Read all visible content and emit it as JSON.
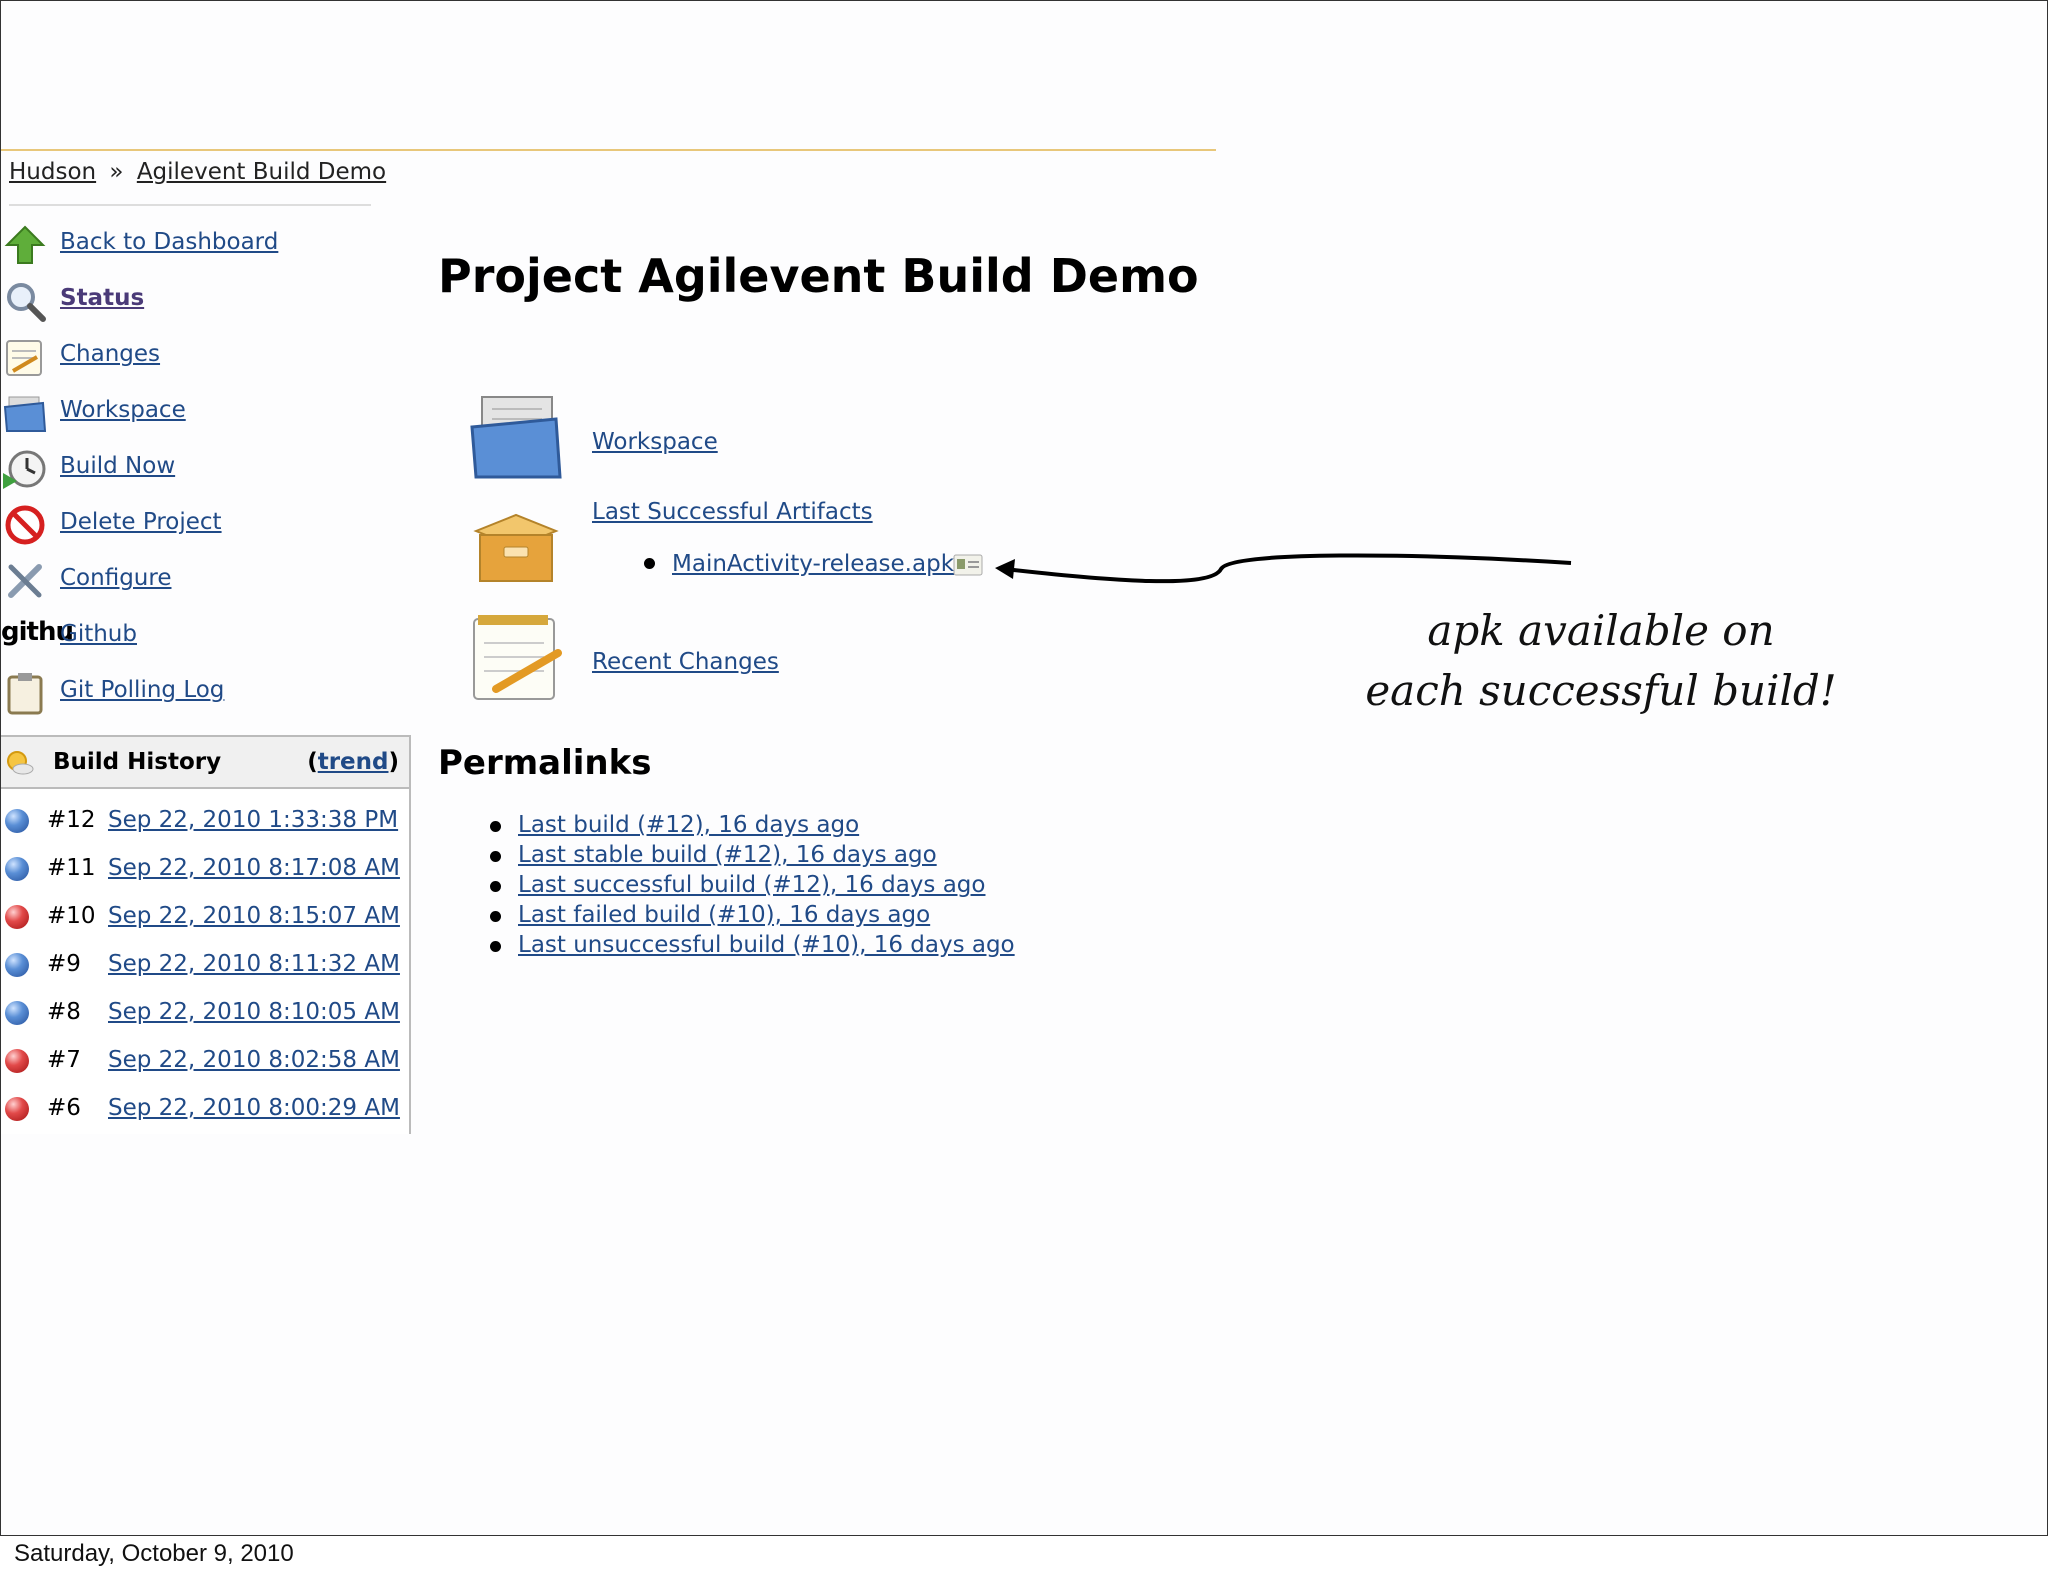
{
  "breadcrumb": {
    "root": "Hudson",
    "separator": "»",
    "project": "Agilevent Build Demo"
  },
  "sidebar": {
    "items": [
      {
        "label": "Back to Dashboard",
        "icon": "up-arrow-icon"
      },
      {
        "label": "Status",
        "icon": "magnifier-icon"
      },
      {
        "label": "Changes",
        "icon": "notepad-icon"
      },
      {
        "label": "Workspace",
        "icon": "folder-icon"
      },
      {
        "label": "Build Now",
        "icon": "clock-icon"
      },
      {
        "label": "Delete Project",
        "icon": "no-entry-icon"
      },
      {
        "label": "Configure",
        "icon": "tools-icon"
      },
      {
        "label": "Github",
        "icon": "github-icon",
        "icon_text": "githu"
      },
      {
        "label": "Git Polling Log",
        "icon": "clipboard-icon"
      }
    ]
  },
  "build_history": {
    "title": "Build History",
    "trend_open": "(",
    "trend_label": "trend",
    "trend_close": ")",
    "builds": [
      {
        "number": "#12",
        "date": "Sep 22, 2010 1:33:38 PM",
        "status": "blue"
      },
      {
        "number": "#11",
        "date": "Sep 22, 2010 8:17:08 AM",
        "status": "blue"
      },
      {
        "number": "#10",
        "date": "Sep 22, 2010 8:15:07 AM",
        "status": "red"
      },
      {
        "number": "#9",
        "date": "Sep 22, 2010 8:11:32 AM",
        "status": "blue"
      },
      {
        "number": "#8",
        "date": "Sep 22, 2010 8:10:05 AM",
        "status": "blue"
      },
      {
        "number": "#7",
        "date": "Sep 22, 2010 8:02:58 AM",
        "status": "red"
      },
      {
        "number": "#6",
        "date": "Sep 22, 2010 8:00:29 AM",
        "status": "red"
      }
    ]
  },
  "main": {
    "title": "Project Agilevent Build Demo",
    "workspace_link": "Workspace",
    "artifacts_link": "Last Successful Artifacts",
    "artifact_file": "MainActivity-release.apk",
    "recent_changes_link": "Recent Changes"
  },
  "permalinks": {
    "title": "Permalinks",
    "items": [
      "Last build (#12), 16 days ago",
      "Last stable build (#12), 16 days ago",
      "Last successful build (#12), 16 days ago",
      "Last failed build (#10), 16 days ago",
      "Last unsuccessful build (#10), 16 days ago"
    ]
  },
  "annotation": {
    "line1": "apk available on",
    "line2": "each successful build!"
  },
  "footer": {
    "date": "Saturday, October 9, 2010"
  },
  "colors": {
    "link": "#204a87",
    "accent_line": "#e8c77a",
    "success": "#5a8fd6",
    "failure": "#e24a4a"
  }
}
